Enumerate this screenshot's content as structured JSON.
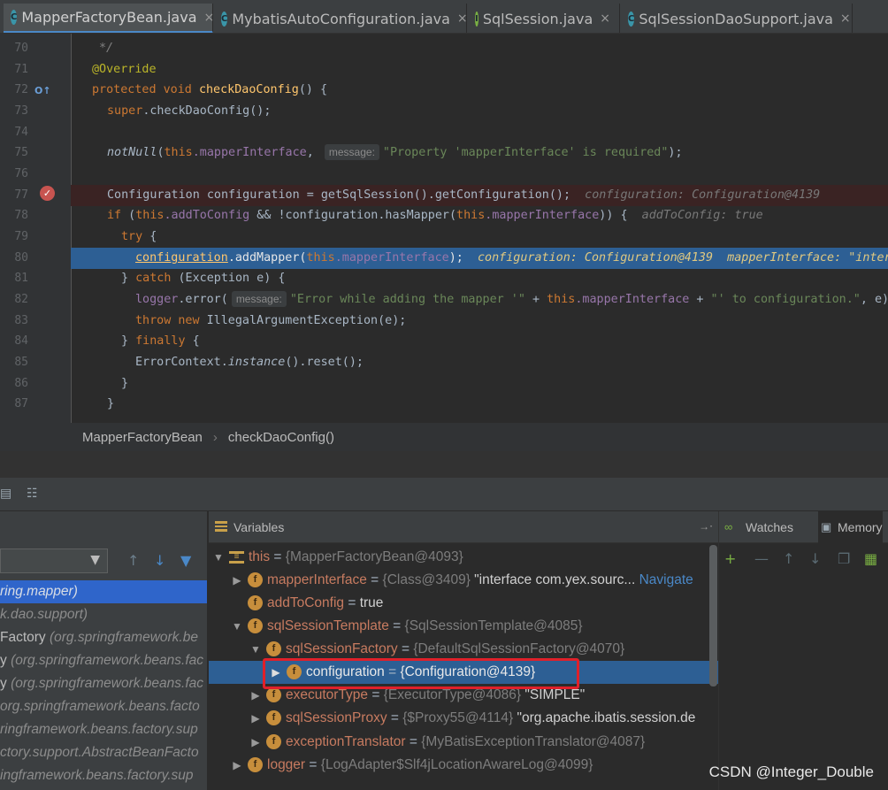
{
  "tabs": [
    {
      "label": "MapperFactoryBean.java",
      "icon": "c",
      "active": true
    },
    {
      "label": "MybatisAutoConfiguration.java",
      "icon": "c",
      "active": false
    },
    {
      "label": "SqlSession.java",
      "icon": "i",
      "active": false
    },
    {
      "label": "SqlSessionDaoSupport.java",
      "icon": "c",
      "active": false
    }
  ],
  "close_glyph": "×",
  "editor": {
    "line_numbers": [
      "70",
      "71",
      "72",
      "73",
      "74",
      "75",
      "76",
      "77",
      "78",
      "79",
      "80",
      "81",
      "82",
      "83",
      "84",
      "85",
      "86",
      "87"
    ],
    "lines": {
      "l70": "*/",
      "l71": "@Override",
      "l72_kw": "protected void",
      "l72_fn": "checkDaoConfig",
      "l72_rest": "() {",
      "l73_kw": "super",
      "l73_rest": ".checkDaoConfig();",
      "l75_fn": "notNull",
      "l75_a": "(",
      "l75_this": "this",
      "l75_fld": ".mapperInterface",
      "l75_comma": ",",
      "l75_hint": "message:",
      "l75_str": "\"Property 'mapperInterface' is required\"",
      "l75_end": ");",
      "l77_code": "Configuration configuration = getSqlSession().getConfiguration();",
      "l77_inline": "configuration: Configuration@4139",
      "l78_kw": "if",
      "l78_a": " (",
      "l78_this": "this",
      "l78_fld": ".addToConfig",
      "l78_b": " && !configuration.hasMapper(",
      "l78_this2": "this",
      "l78_fld2": ".mapperInterface",
      "l78_c": ")) {",
      "l78_inline": "addToConfig: true",
      "l79_kw": "try",
      "l79_rest": " {",
      "l80_a": "configuration",
      "l80_b": ".addMapper(",
      "l80_this": "this",
      "l80_fld": ".mapperInterface",
      "l80_c": ");",
      "l80_inline1": "configuration: Configuration@4139",
      "l80_inline2": "mapperInterface: \"inter",
      "l81_a": "} ",
      "l81_kw": "catch",
      "l81_rest": " (Exception e) {",
      "l82_fld": "logger",
      "l82_a": ".error(",
      "l82_hint": "message:",
      "l82_str": "\"Error while adding the mapper '\"",
      "l82_b": " + ",
      "l82_this": "this",
      "l82_fld2": ".mapperInterface",
      "l82_c": " + ",
      "l82_str2": "\"' to configuration.\"",
      "l82_d": ", e)",
      "l83_kw": "throw new",
      "l83_rest": " IllegalArgumentException(e);",
      "l84_a": "} ",
      "l84_kw": "finally",
      "l84_rest": " {",
      "l85_a": "ErrorContext.",
      "l85_it": "instance",
      "l85_rest": "().reset();",
      "l86": "}",
      "l87": "}"
    }
  },
  "breadcrumb": {
    "class_name": "MapperFactoryBean",
    "method_name": "checkDaoConfig()",
    "separator": "›"
  },
  "frames": [
    {
      "prefix": "",
      "pkg": "ring.mapper)",
      "selected": true
    },
    {
      "prefix": "",
      "pkg": "k.dao.support)",
      "selected": false
    },
    {
      "prefix": "Factory ",
      "pkg": "(org.springframework.be",
      "selected": false
    },
    {
      "prefix": "y ",
      "pkg": "(org.springframework.beans.fac",
      "selected": false
    },
    {
      "prefix": "y ",
      "pkg": "(org.springframework.beans.fac",
      "selected": false
    },
    {
      "prefix": "",
      "pkg": "org.springframework.beans.facto",
      "selected": false
    },
    {
      "prefix": "",
      "pkg": "ringframework.beans.factory.sup",
      "selected": false
    },
    {
      "prefix": "",
      "pkg": "ctory.support.AbstractBeanFacto",
      "selected": false
    },
    {
      "prefix": "",
      "pkg": "ingframework.beans.factory.sup",
      "selected": false
    }
  ],
  "variables_title": "Variables",
  "variables": [
    {
      "name": "this",
      "ref": "{MapperFactoryBean@4093}",
      "val": "",
      "nav": ""
    },
    {
      "name": "mapperInterface",
      "ref": "{Class@3409}",
      "val": " \"interface com.yex.sourc...",
      "nav": "Navigate"
    },
    {
      "name": "addToConfig",
      "ref": "",
      "val": "true",
      "nav": ""
    },
    {
      "name": "sqlSessionTemplate",
      "ref": "{SqlSessionTemplate@4085}",
      "val": "",
      "nav": ""
    },
    {
      "name": "sqlSessionFactory",
      "ref": "{DefaultSqlSessionFactory@4070}",
      "val": "",
      "nav": ""
    },
    {
      "name": "configuration",
      "ref": "{Configuration@4139}",
      "val": "",
      "nav": ""
    },
    {
      "name": "executorType",
      "ref": "{ExecutorType@4086}",
      "val": " \"SIMPLE\"",
      "nav": ""
    },
    {
      "name": "sqlSessionProxy",
      "ref": "{$Proxy55@4114}",
      "val": " \"org.apache.ibatis.session.de",
      "nav": ""
    },
    {
      "name": "exceptionTranslator",
      "ref": "{MyBatisExceptionTranslator@4087}",
      "val": "",
      "nav": ""
    },
    {
      "name": "logger",
      "ref": "{LogAdapter$Slf4jLocationAwareLog@4099}",
      "val": "",
      "nav": ""
    }
  ],
  "eq": " = ",
  "watches_title": "Watches",
  "memory_title": "Memory",
  "watermark": "CSDN @Integer_Double",
  "colors": {
    "accent": "#2d5f94",
    "highlight_box": "#e0202a",
    "breakpoint": "#c75450"
  }
}
